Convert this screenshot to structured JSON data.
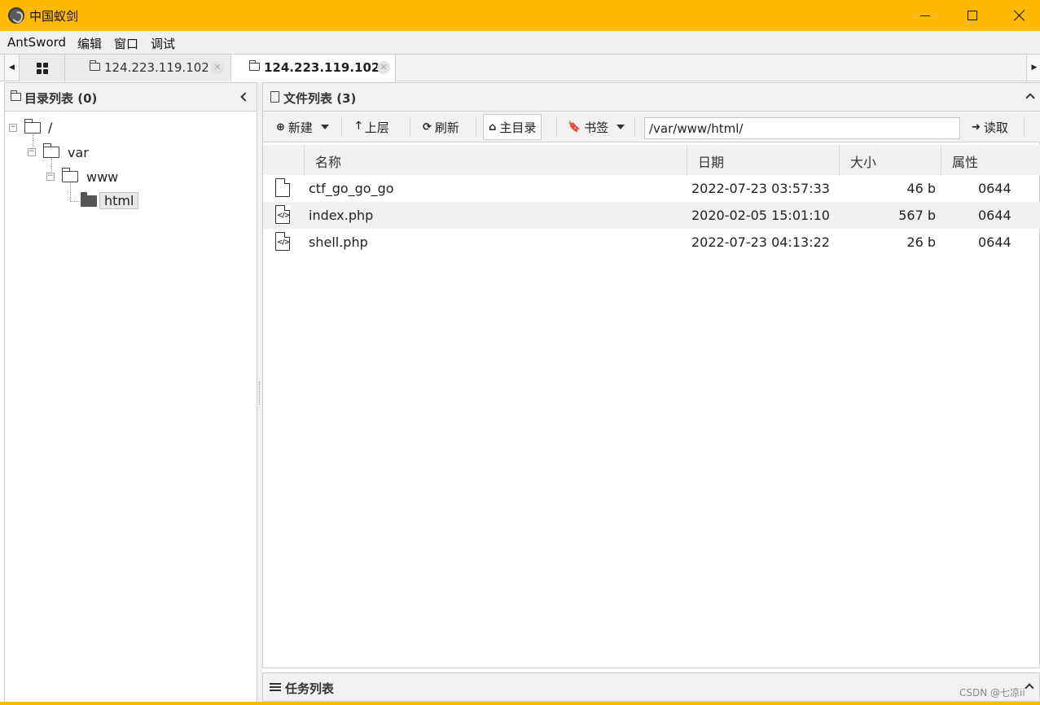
{
  "window": {
    "title": "中国蚁剑",
    "accent_color": "#ffb900"
  },
  "menu": [
    "AntSword",
    "编辑",
    "窗口",
    "调试"
  ],
  "tabs": [
    {
      "label": "124.223.119.102",
      "active": false
    },
    {
      "label": "124.223.119.102",
      "active": true
    }
  ],
  "dir_panel": {
    "title": "目录列表 (0)",
    "tree": [
      {
        "label": "/"
      },
      {
        "label": "var"
      },
      {
        "label": "www"
      },
      {
        "label": "html",
        "selected": true
      }
    ]
  },
  "file_panel": {
    "title": "文件列表 (3)",
    "toolbar": {
      "new": "新建",
      "up": "上层",
      "refresh": "刷新",
      "home": "主目录",
      "bookmark": "书签",
      "path": "/var/www/html/",
      "read": "读取"
    },
    "columns": [
      "名称",
      "日期",
      "大小",
      "属性"
    ],
    "files": [
      {
        "name": "ctf_go_go_go",
        "date": "2022-07-23 03:57:33",
        "size": "46 b",
        "perm": "0644",
        "icon": "file-icon"
      },
      {
        "name": "index.php",
        "date": "2020-02-05 15:01:10",
        "size": "567 b",
        "perm": "0644",
        "icon": "code-file-icon"
      },
      {
        "name": "shell.php",
        "date": "2022-07-23 04:13:22",
        "size": "26 b",
        "perm": "0644",
        "icon": "code-file-icon"
      }
    ]
  },
  "tasks": {
    "title": "任务列表"
  },
  "watermark": "CSDN @七凉ii"
}
